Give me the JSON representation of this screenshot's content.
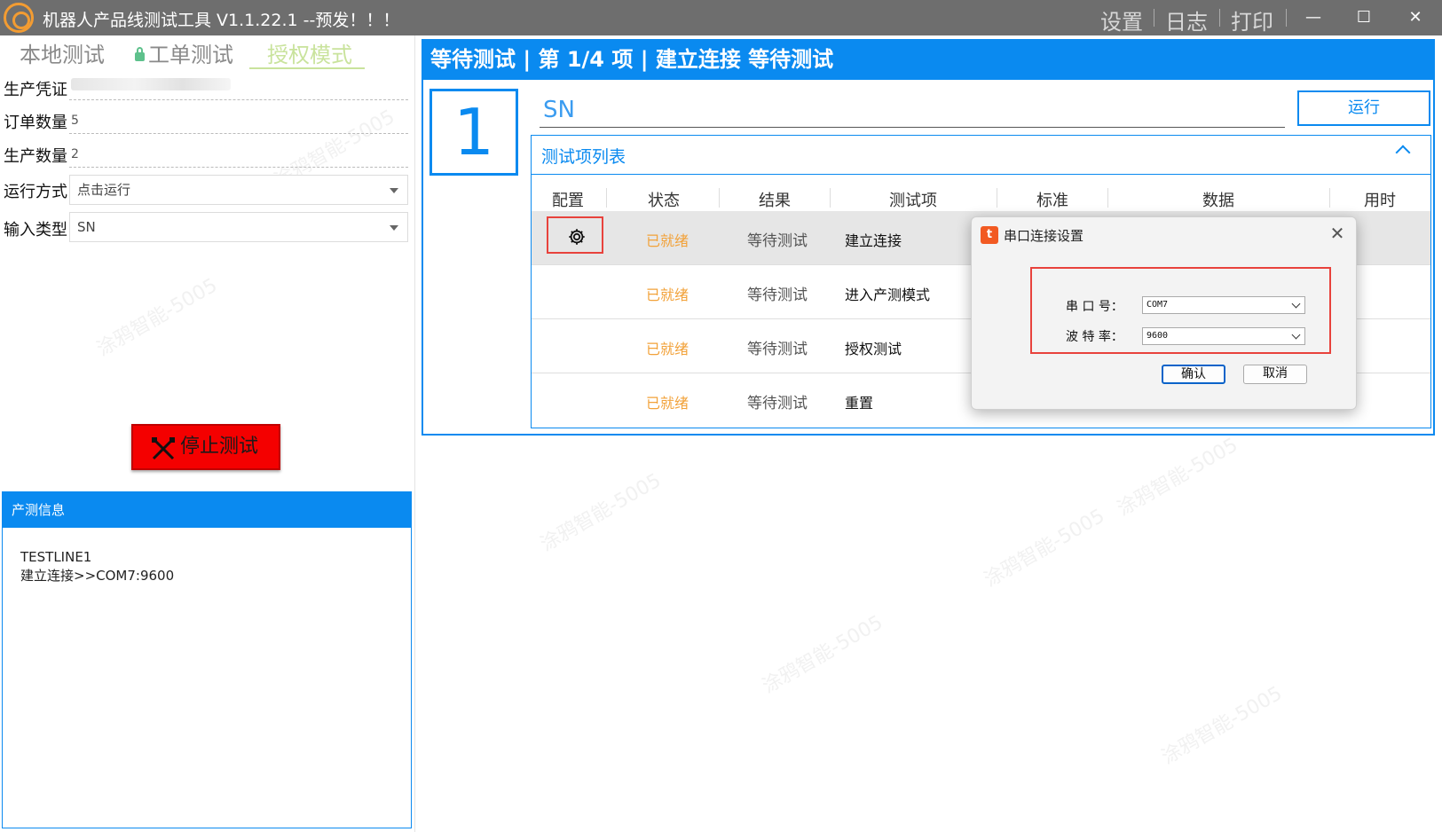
{
  "titlebar": {
    "title": "机器人产品线测试工具 V1.1.22.1 --预发！！！",
    "menu_settings": "设置",
    "menu_log": "日志",
    "menu_print": "打印",
    "minimize": "—",
    "maximize": "☐",
    "close": "✕"
  },
  "left": {
    "tabs": [
      "本地测试",
      "工单测试",
      "授权模式"
    ],
    "active_tab": "授权模式",
    "fields": {
      "credential_label": "生产凭证",
      "order_qty_label": "订单数量",
      "order_qty_value": "5",
      "produced_qty_label": "生产数量",
      "produced_qty_value": "2",
      "run_mode_label": "运行方式",
      "run_mode_value": "点击运行",
      "input_type_label": "输入类型",
      "input_type_value": "SN"
    },
    "stop_button": "停止测试",
    "info": {
      "header": "产测信息",
      "lines": [
        "TESTLINE1",
        "建立连接>>COM7:9600"
      ]
    }
  },
  "main": {
    "header": "等待测试 | 第 1/4 项 | 建立连接 等待测试",
    "step_number": "1",
    "sn_value": "SN",
    "run_button": "运行",
    "list_title": "测试项列表",
    "columns": [
      "配置",
      "状态",
      "结果",
      "测试项",
      "标准",
      "数据",
      "用时"
    ],
    "rows": [
      {
        "status": "已就绪",
        "result": "等待测试",
        "item": "建立连接"
      },
      {
        "status": "已就绪",
        "result": "等待测试",
        "item": "进入产测模式"
      },
      {
        "status": "已就绪",
        "result": "等待测试",
        "item": "授权测试"
      },
      {
        "status": "已就绪",
        "result": "等待测试",
        "item": "重置"
      }
    ]
  },
  "dialog": {
    "icon": "t",
    "title": "串口连接设置",
    "port_label": "串 口 号：",
    "port_value": "COM7",
    "baud_label": "波 特 率：",
    "baud_value": "9600",
    "confirm": "确认",
    "cancel": "取消"
  },
  "watermark_text": "涂鸦智能-5005",
  "colors": {
    "accent": "#0a8af0",
    "stop": "#f40000",
    "status_ready": "#f2a23a",
    "highlight": "#e8423c",
    "active_tab": "#c9e39c"
  }
}
